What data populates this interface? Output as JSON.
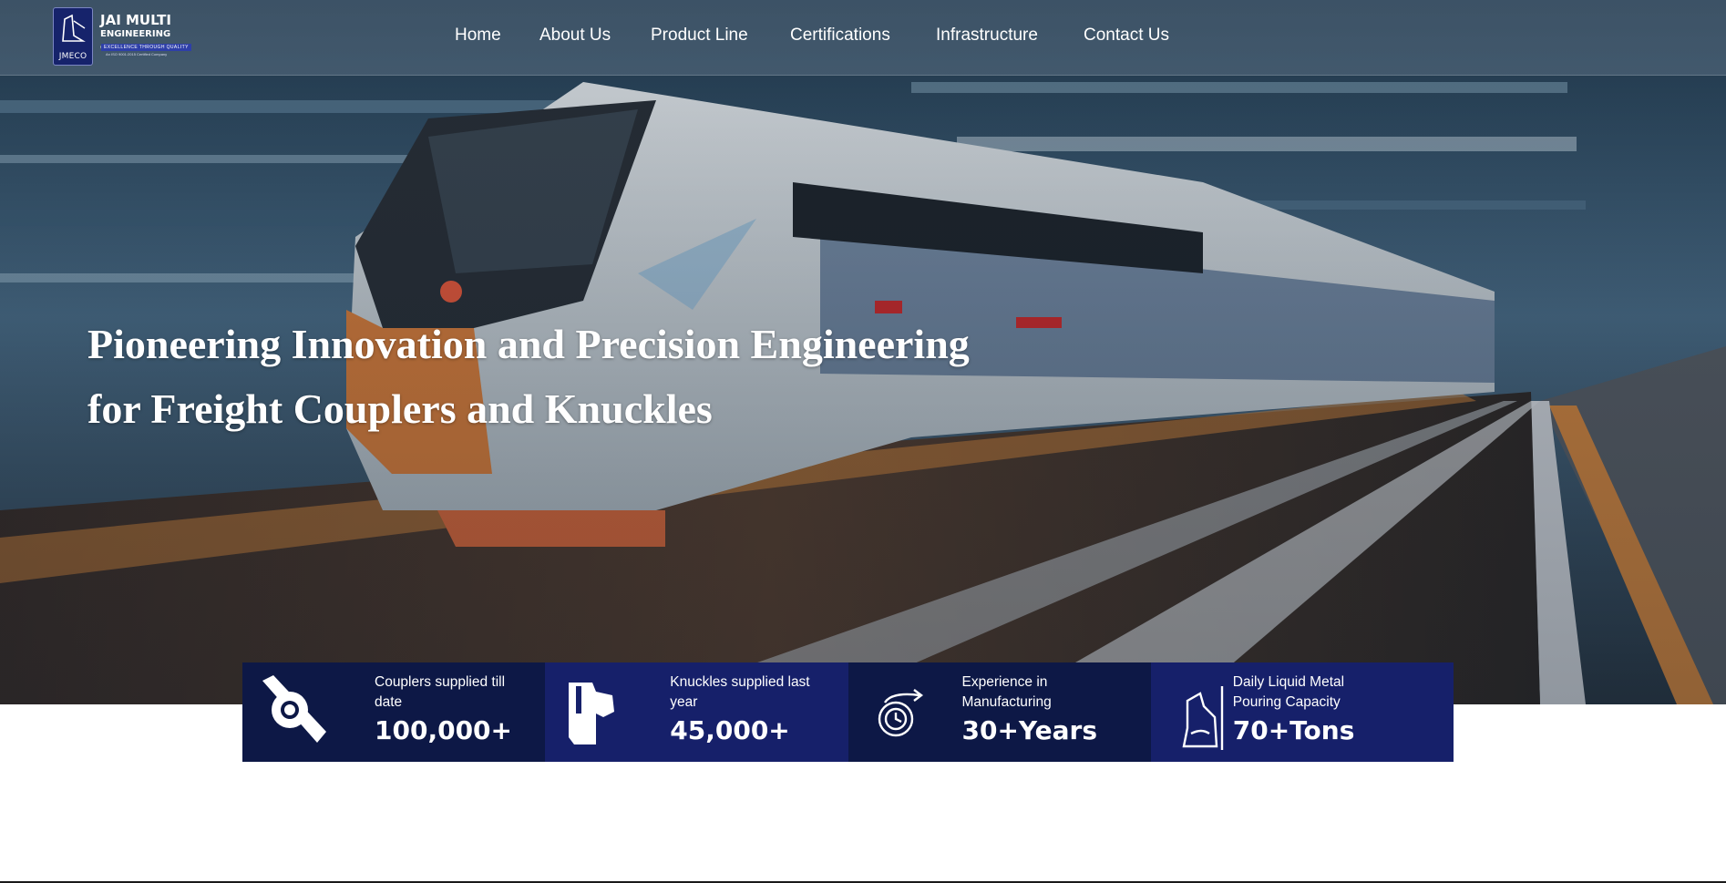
{
  "brand": {
    "name_line1": "JAI MULTI",
    "name_line2": "ENGINEERING CO.",
    "tagline": "EXCELLENCE THROUGH QUALITY",
    "certification_note": "An ISO 9001:2015 Certified Company",
    "monogram": "JMECO",
    "logo_color": "#16236b"
  },
  "nav": {
    "items": [
      {
        "label": "Home"
      },
      {
        "label": "About Us"
      },
      {
        "label": "Product Line"
      },
      {
        "label": "Certifications"
      },
      {
        "label": "Infrastructure"
      },
      {
        "label": "Contact Us"
      }
    ]
  },
  "hero": {
    "headline_line1": "Pioneering Innovation and Precision Engineering",
    "headline_line2": "for Freight Couplers and Knuckles",
    "image_subject": "high-speed-train"
  },
  "stats": [
    {
      "icon": "coupler-icon",
      "label": "Couplers supplied till date",
      "value": "100,000+",
      "bg": "#0d1846"
    },
    {
      "icon": "knuckle-icon",
      "label": "Knuckles supplied last year",
      "value": "45,000+",
      "bg": "#16206a"
    },
    {
      "icon": "experience-clock-icon",
      "label": "Experience in Manufacturing",
      "value": "30+Years",
      "bg": "#0d1846"
    },
    {
      "icon": "ladle-pour-icon",
      "label": "Daily Liquid Metal Pouring Capacity",
      "value": "70+Tons",
      "bg": "#16206a"
    }
  ]
}
